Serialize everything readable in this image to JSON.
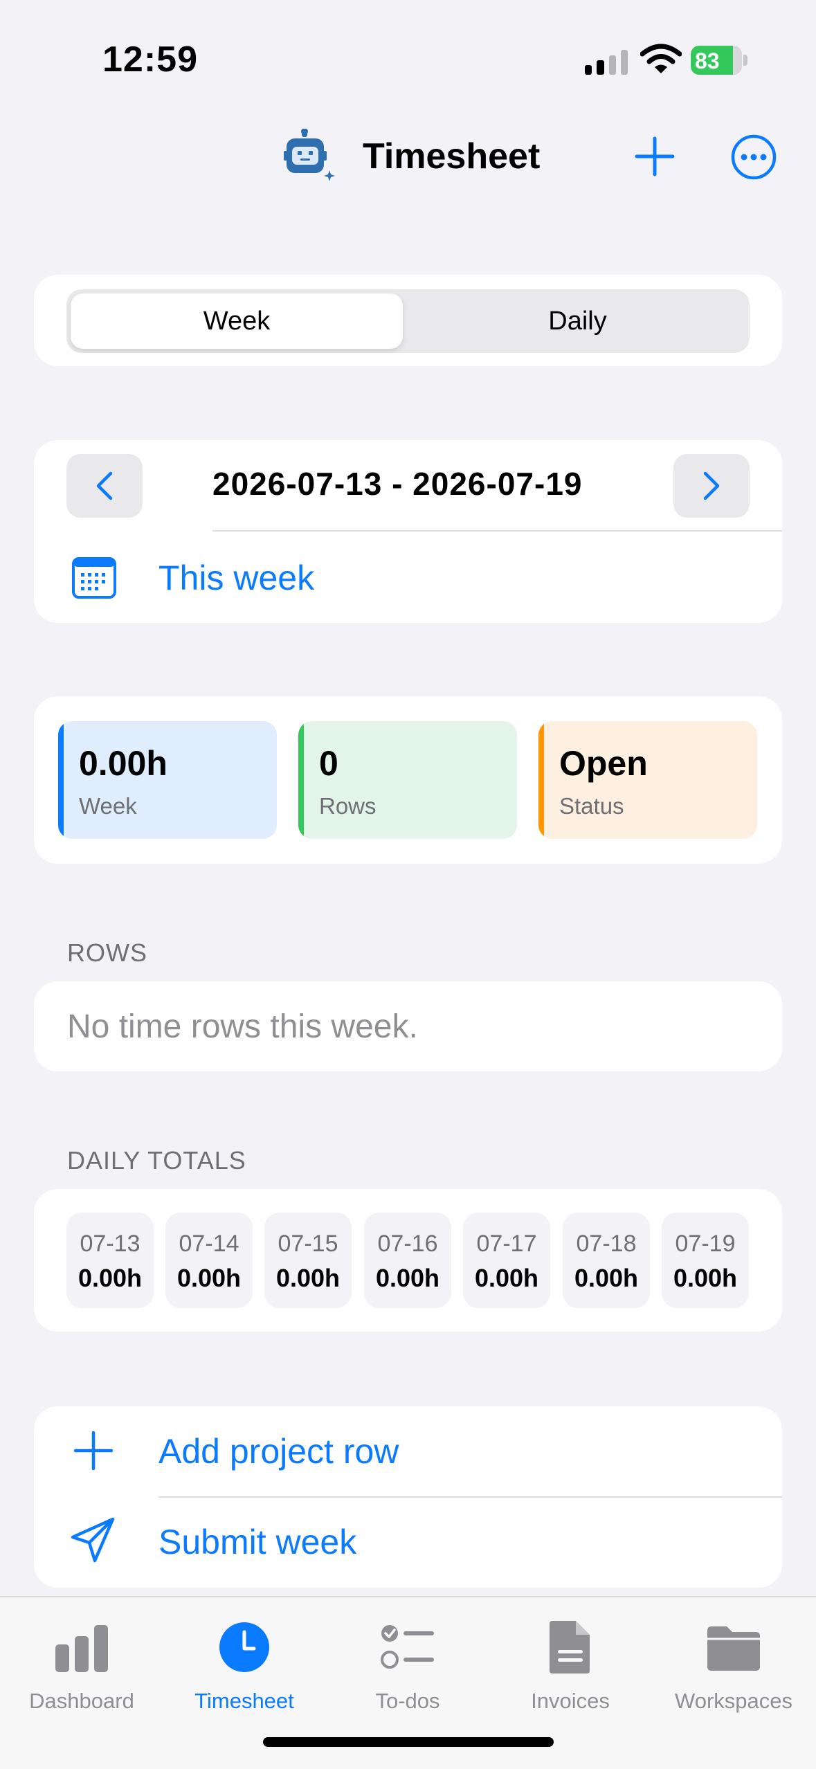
{
  "status_bar": {
    "time": "12:59",
    "battery_level": "83",
    "battery_fraction": 0.83
  },
  "nav": {
    "title": "Timesheet",
    "logo_icon": "robot-sparkle-icon",
    "add_icon": "plus-icon",
    "more_icon": "ellipsis-circle-icon"
  },
  "segment": {
    "week": "Week",
    "daily": "Daily",
    "selected": "Week"
  },
  "date_nav": {
    "range": "2026-07-13 - 2026-07-19",
    "this_week": "This week"
  },
  "stats": [
    {
      "value": "0.00h",
      "label": "Week",
      "accent": "#0A7AFF"
    },
    {
      "value": "0",
      "label": "Rows",
      "accent": "#34C759"
    },
    {
      "value": "Open",
      "label": "Status",
      "accent": "#FF9500"
    }
  ],
  "rows_section": {
    "header": "ROWS",
    "empty": "No time rows this week."
  },
  "daily_totals": {
    "header": "DAILY TOTALS",
    "days": [
      {
        "date": "07-13",
        "hours": "0.00h"
      },
      {
        "date": "07-14",
        "hours": "0.00h"
      },
      {
        "date": "07-15",
        "hours": "0.00h"
      },
      {
        "date": "07-16",
        "hours": "0.00h"
      },
      {
        "date": "07-17",
        "hours": "0.00h"
      },
      {
        "date": "07-18",
        "hours": "0.00h"
      },
      {
        "date": "07-19",
        "hours": "0.00h"
      }
    ]
  },
  "actions": {
    "add_row": "Add project row",
    "submit": "Submit week"
  },
  "tabs": [
    {
      "label": "Dashboard",
      "icon": "chart-bar-icon"
    },
    {
      "label": "Timesheet",
      "icon": "clock-icon",
      "active": true
    },
    {
      "label": "To-dos",
      "icon": "checklist-icon"
    },
    {
      "label": "Invoices",
      "icon": "document-icon"
    },
    {
      "label": "Workspaces",
      "icon": "folder-icon"
    }
  ],
  "colors": {
    "accent": "#0A7AFF",
    "background": "#F2F2F7"
  }
}
